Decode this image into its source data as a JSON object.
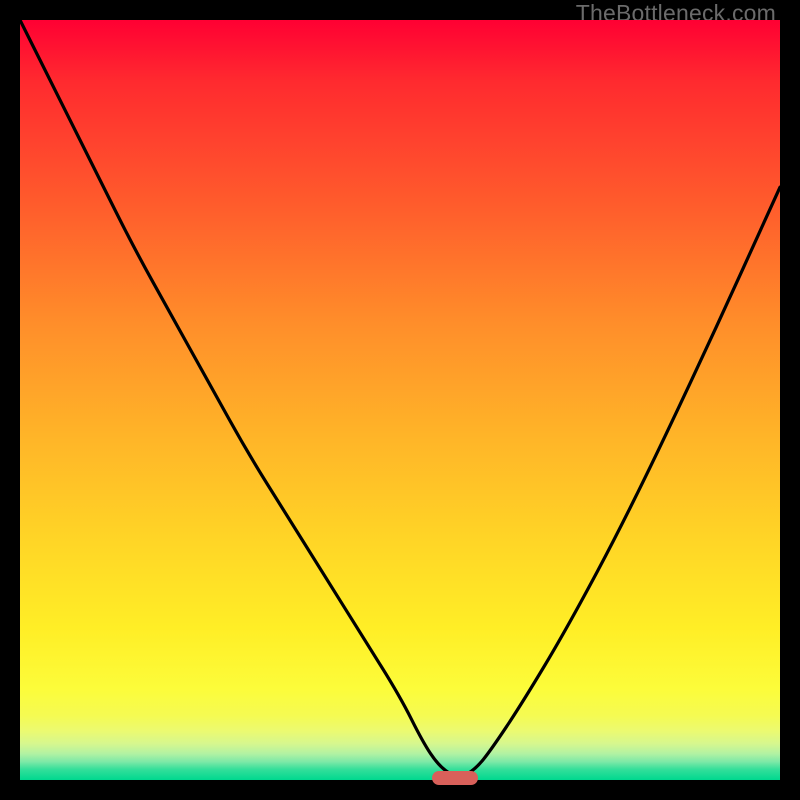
{
  "watermark": {
    "text": "TheBottleneck.com"
  },
  "chart_data": {
    "type": "line",
    "title": "",
    "xlabel": "",
    "ylabel": "",
    "xlim": [
      0,
      100
    ],
    "ylim": [
      0,
      100
    ],
    "series": [
      {
        "name": "bottleneck-curve",
        "x": [
          0,
          5,
          10,
          15,
          20,
          25,
          30,
          35,
          40,
          45,
          50,
          53,
          55,
          57,
          58,
          60,
          62,
          66,
          72,
          80,
          90,
          100
        ],
        "values": [
          100,
          90,
          80,
          70,
          61,
          52,
          43,
          35,
          27,
          19,
          11,
          5,
          2,
          0.5,
          0.3,
          1.5,
          4,
          10,
          20,
          35,
          56,
          78
        ]
      }
    ],
    "marker": {
      "x": 57.3,
      "y": 0.3,
      "shape": "pill",
      "color": "#d8605a"
    },
    "background_gradient": {
      "direction": "top-to-bottom",
      "stops": [
        {
          "pos": 0.0,
          "color": "#ff0033"
        },
        {
          "pos": 0.55,
          "color": "#ffb528"
        },
        {
          "pos": 0.88,
          "color": "#fcfc3a"
        },
        {
          "pos": 1.0,
          "color": "#00d88f"
        }
      ]
    }
  }
}
